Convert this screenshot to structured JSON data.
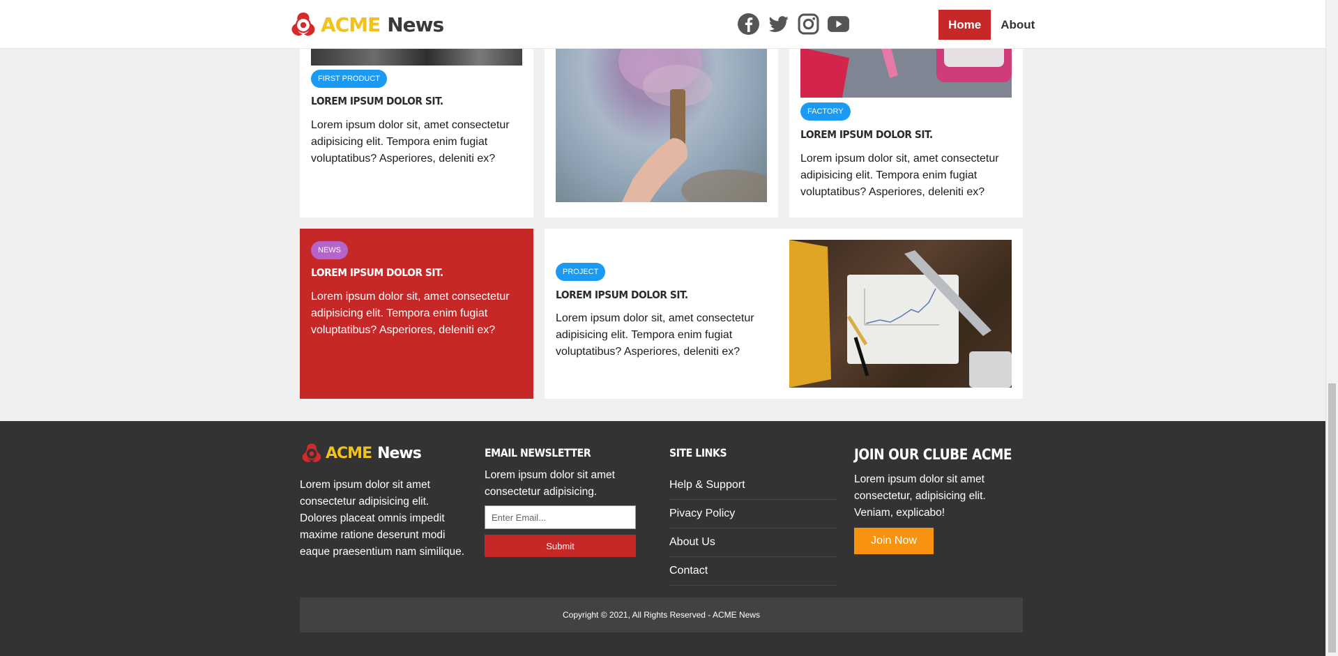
{
  "header": {
    "logo": {
      "acme": "ACME",
      "news": "News"
    },
    "social": [
      "facebook-icon",
      "twitter-icon",
      "instagram-icon",
      "youtube-icon"
    ],
    "nav": {
      "home": "Home",
      "about": "About"
    }
  },
  "cards": {
    "first_product": {
      "badge": "FIRST PRODUCT",
      "title": "LOREM IPSUM DOLOR SIT.",
      "text": "Lorem ipsum dolor sit, amet consectetur adipisicing elit. Tempora enim fugiat voluptatibus? Asperiores, deleniti ex?"
    },
    "factory": {
      "badge": "FACTORY",
      "title": "LOREM IPSUM DOLOR SIT.",
      "text": "Lorem ipsum dolor sit, amet consectetur adipisicing elit. Tempora enim fugiat voluptatibus? Asperiores, deleniti ex?"
    },
    "news": {
      "badge": "NEWS",
      "title": "LOREM IPSUM DOLOR SIT.",
      "text": "Lorem ipsum dolor sit, amet consectetur adipisicing elit. Tempora enim fugiat voluptatibus? Asperiores, deleniti ex?"
    },
    "project": {
      "badge": "PROJECT",
      "title": "LOREM IPSUM DOLOR SIT.",
      "text": "Lorem ipsum dolor sit, amet consectetur adipisicing elit. Tempora enim fugiat voluptatibus? Asperiores, deleniti ex?"
    }
  },
  "footer": {
    "logo": {
      "acme": "ACME",
      "news": "News"
    },
    "about_text": "Lorem ipsum dolor sit amet consectetur adipisicing elit. Dolores placeat omnis impedit maxime ratione deserunt modi eaque praesentium nam similique.",
    "newsletter": {
      "heading": "EMAIL NEWSLETTER",
      "text": "Lorem ipsum dolor sit amet consectetur adipisicing.",
      "placeholder": "Enter Email...",
      "submit": "Submit"
    },
    "site_links": {
      "heading": "SITE LINKS",
      "items": [
        "Help & Support",
        "Pivacy Policy",
        "About Us",
        "Contact"
      ]
    },
    "club": {
      "heading": "JOIN OUR CLUBE ACME",
      "text": "Lorem ipsum dolor sit amet consectetur, adipisicing elit. Veniam, explicabo!",
      "button": "Join Now"
    },
    "copyright": "Copyright © 2021, All Rights Reserved - ACME News"
  },
  "colors": {
    "brand_red": "#c62828",
    "brand_yellow": "#f2c21b",
    "badge_blue": "#1a9af2",
    "badge_purple": "#b565c9",
    "join_orange": "#f7930e",
    "footer_bg": "#333333"
  }
}
